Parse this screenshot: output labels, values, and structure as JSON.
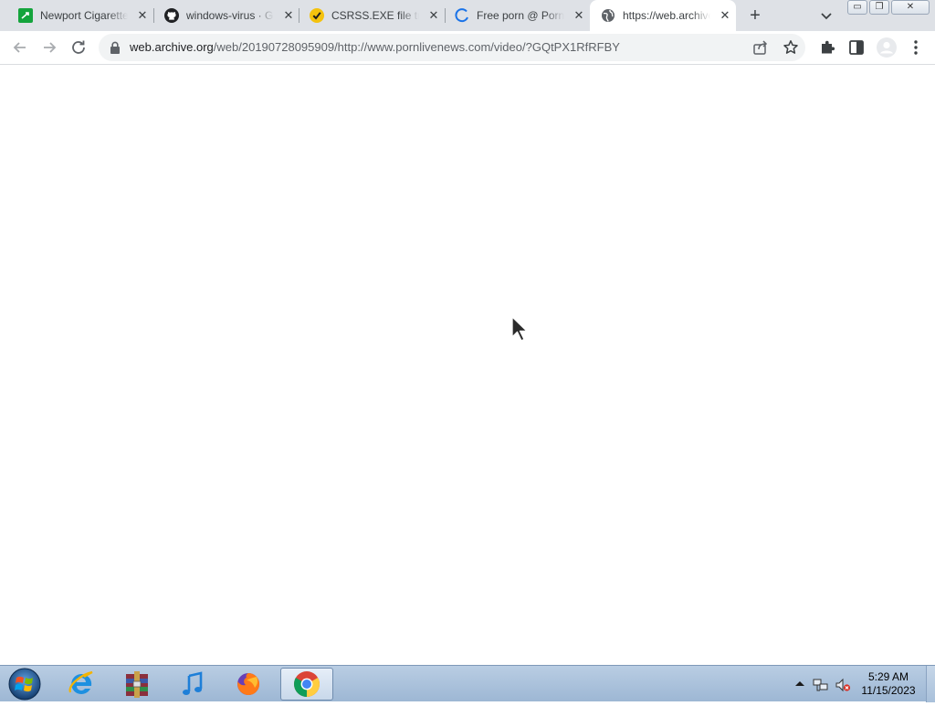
{
  "browser": {
    "tabs": [
      {
        "title": "Newport Cigarettes",
        "icon": "newport-favicon",
        "close": "✕"
      },
      {
        "title": "windows-virus · GitHub",
        "icon": "github-favicon",
        "close": "✕"
      },
      {
        "title": "CSRSS.EXE file trojan",
        "icon": "checkmark-favicon",
        "close": "✕"
      },
      {
        "title": "Free porn @ Porn",
        "icon": "loading-spinner-favicon",
        "close": "✕"
      },
      {
        "title": "https://web.archive.org",
        "icon": "globe-favicon",
        "close": "✕",
        "active": true
      }
    ],
    "new_tab_label": "+",
    "window_buttons": {
      "minimize": "▭",
      "restore": "❐",
      "close": "✕"
    },
    "url": {
      "host": "web.archive.org",
      "path": "/web/20190728095909/http://www.pornlivenews.com/video/?GQtPX1RfRFBY"
    },
    "accent_color": "#1a73e8"
  },
  "taskbar": {
    "apps": [
      {
        "name": "internet-explorer"
      },
      {
        "name": "winrar-archive"
      },
      {
        "name": "itunes"
      },
      {
        "name": "firefox"
      },
      {
        "name": "chrome",
        "active": true
      }
    ],
    "clock": {
      "time": "5:29 AM",
      "date": "11/15/2023"
    },
    "tray_icons": [
      "show-hidden-icons-arrow",
      "network-icon",
      "volume-muted-icon"
    ]
  }
}
